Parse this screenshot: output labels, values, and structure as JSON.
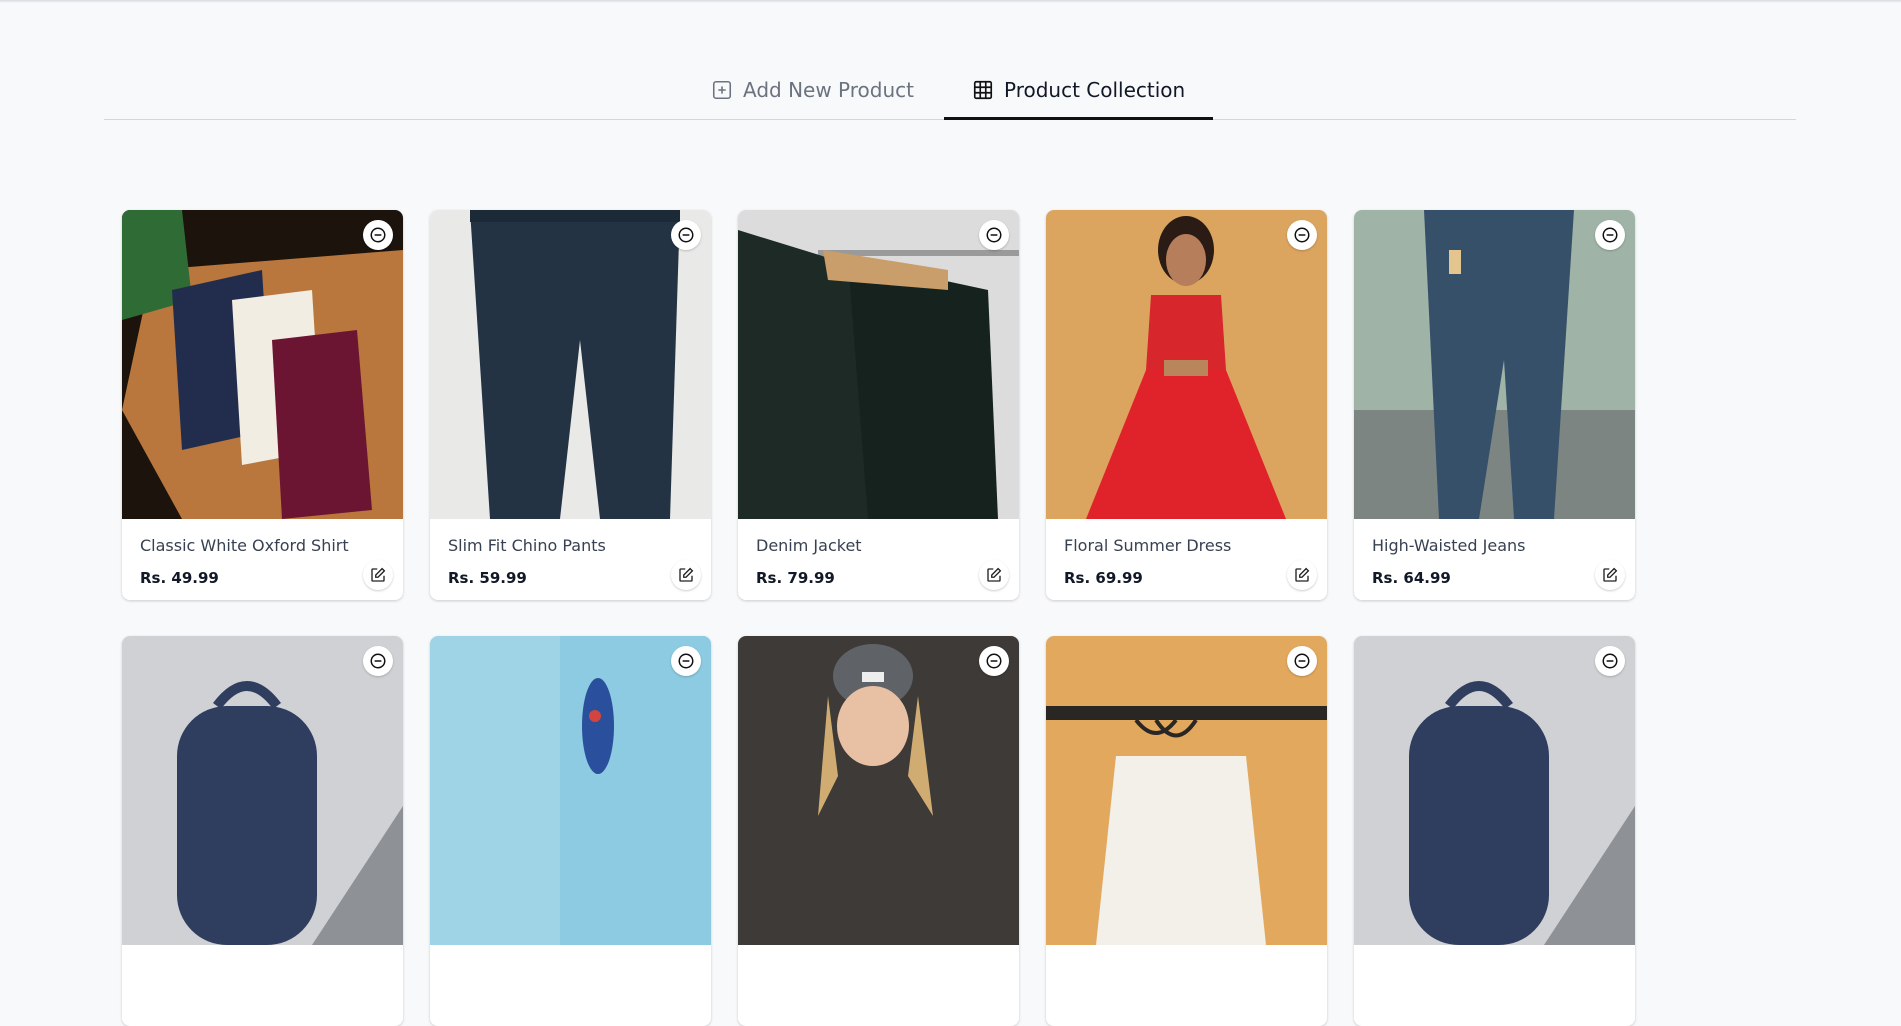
{
  "tabs": {
    "add_label": "Add New Product",
    "add_icon": "plus-square-icon",
    "collection_label": "Product Collection",
    "collection_icon": "grid-icon",
    "active": "collection"
  },
  "colors": {
    "background": "#f8f9fb",
    "active_tab_underline": "#111111",
    "inactive_tab_text": "#6b7280"
  },
  "products": [
    {
      "name": "Classic White Oxford Shirt",
      "price": "Rs. 49.99",
      "image": "folded-shirts-photo"
    },
    {
      "name": "Slim Fit Chino Pants",
      "price": "Rs. 59.99",
      "image": "dark-pants-photo"
    },
    {
      "name": "Denim Jacket",
      "price": "Rs. 79.99",
      "image": "black-tshirts-rack-photo"
    },
    {
      "name": "Floral Summer Dress",
      "price": "Rs. 69.99",
      "image": "red-dress-photo"
    },
    {
      "name": "High-Waisted Jeans",
      "price": "Rs. 64.99",
      "image": "patched-jeans-photo"
    },
    {
      "name": "",
      "price": "",
      "image": "blue-backpack-photo"
    },
    {
      "name": "",
      "price": "",
      "image": "floral-sandal-photo"
    },
    {
      "name": "",
      "price": "",
      "image": "beanie-portrait-photo"
    },
    {
      "name": "",
      "price": "",
      "image": "hangers-rack-photo"
    },
    {
      "name": "",
      "price": "",
      "image": "blue-backpack-photo"
    }
  ],
  "card_actions": {
    "remove_icon": "minus-circle-icon",
    "edit_icon": "edit-icon"
  }
}
